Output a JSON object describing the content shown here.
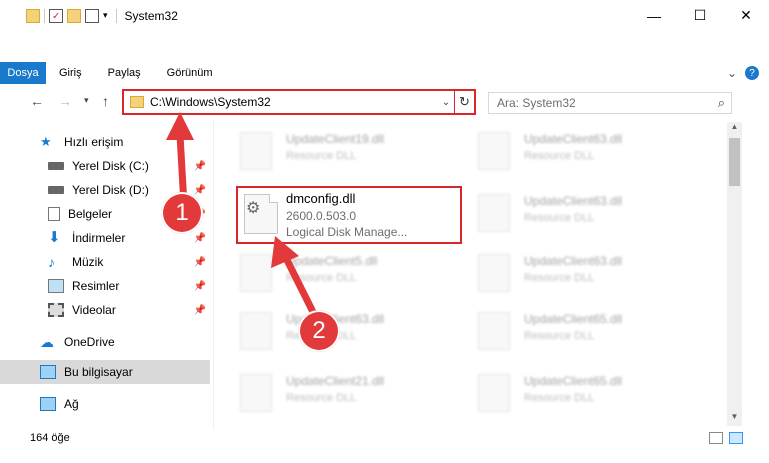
{
  "window": {
    "title": "System32"
  },
  "controls": {
    "minimize": "—",
    "maximize": "☐",
    "close": "✕"
  },
  "ribbon": {
    "tabs": [
      "Dosya",
      "Giriş",
      "Paylaş",
      "Görünüm"
    ]
  },
  "address": {
    "path": "C:\\Windows\\System32",
    "search_placeholder": "Ara: System32"
  },
  "nav": {
    "items": [
      {
        "label": "Hızlı erişim",
        "icon": "star-icon"
      },
      {
        "label": "Yerel Disk (C:)",
        "icon": "drive-icon"
      },
      {
        "label": "Yerel Disk (D:)",
        "icon": "drive-icon"
      },
      {
        "label": "Belgeler",
        "icon": "documents-icon"
      },
      {
        "label": "İndirmeler",
        "icon": "download-icon"
      },
      {
        "label": "Müzik",
        "icon": "music-icon"
      },
      {
        "label": "Resimler",
        "icon": "pictures-icon"
      },
      {
        "label": "Videolar",
        "icon": "videos-icon"
      },
      {
        "label": "OneDrive",
        "icon": "cloud-icon"
      },
      {
        "label": "Bu bilgisayar",
        "icon": "computer-icon"
      },
      {
        "label": "Ağ",
        "icon": "network-icon"
      }
    ]
  },
  "files": {
    "left": [
      {
        "name": "UpdateClient19.dll",
        "sub": "Resource DLL"
      },
      {
        "name": "UpdateClient5.dll",
        "sub": "Resource DLL"
      },
      {
        "name": "UpdateClient63.dll",
        "sub": "Resource DLL"
      },
      {
        "name": "UpdateClient21.dll",
        "sub": "Resource DLL"
      }
    ],
    "right": [
      {
        "name": "UpdateClient63.dll",
        "sub": "Resource DLL"
      },
      {
        "name": "UpdateClient63.dll",
        "sub": "Resource DLL"
      },
      {
        "name": "UpdateClient63.dll",
        "sub": "Resource DLL"
      },
      {
        "name": "UpdateClient65.dll",
        "sub": "Resource DLL"
      },
      {
        "name": "UpdateClient65.dll",
        "sub": "Resource DLL"
      }
    ],
    "selected": {
      "name": "dmconfig.dll",
      "version": "2600.0.503.0",
      "description": "Logical Disk Manage..."
    }
  },
  "status": {
    "count": "164 öğe"
  },
  "annotations": {
    "step1": "1",
    "step2": "2",
    "color": "#e23a3a"
  }
}
